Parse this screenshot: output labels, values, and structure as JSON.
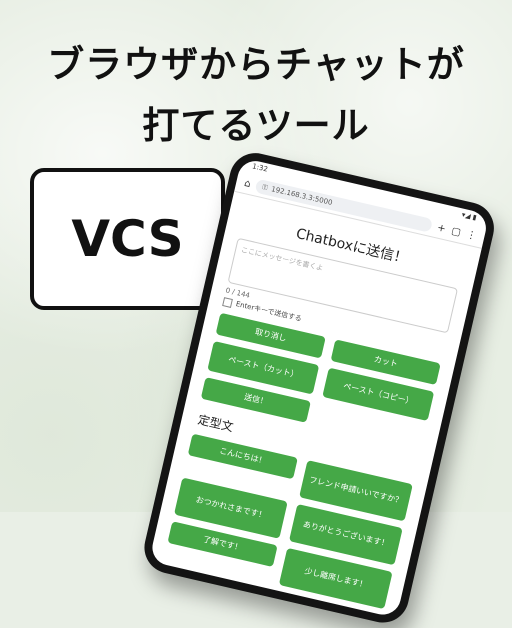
{
  "headline": {
    "line1": "ブラウザからチャットが",
    "line2": "打てるツール"
  },
  "bubble": {
    "text": "VCS"
  },
  "phone": {
    "status_time": "1:32",
    "status_right": "▾◢ ▮",
    "url": "192.168.3.3:5000",
    "page_title": "Chatboxに送信！",
    "textarea_placeholder": "ここにメッセージを書くよ",
    "counter": "0 / 144",
    "enter_option": "Enterキーで送信する",
    "buttons": [
      {
        "label": "取り消し"
      },
      {
        "label": "カット"
      },
      {
        "label": "ペースト（カット）"
      },
      {
        "label": "ペースト（コピー）"
      },
      {
        "label": "送信！"
      }
    ],
    "section_title": "定型文",
    "templates": [
      {
        "label": "こんにちは！"
      },
      {
        "label": "フレンド申請いいですか？"
      },
      {
        "label": "おつかれさまです！"
      },
      {
        "label": "ありがとうございます！"
      },
      {
        "label": "了解です！"
      },
      {
        "label": "少し離席します！"
      }
    ]
  },
  "colors": {
    "button_green": "#45a847",
    "background": "#e7eee3"
  }
}
